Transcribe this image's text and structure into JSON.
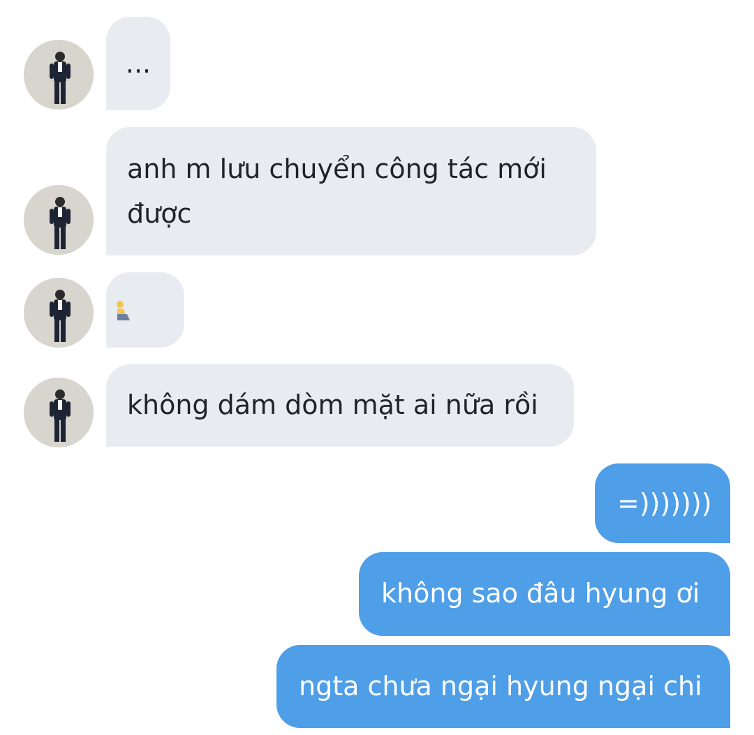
{
  "conversation": {
    "messages": [
      {
        "text": "...",
        "icon": "ellipsis"
      },
      {
        "text": "anh m lưu chuyển công tác mới được"
      },
      {
        "text": "",
        "icon": "person-kneeling-emoji"
      },
      {
        "text": "không dám dòm mặt ai nữa rồi"
      },
      {
        "text": "=)))))))"
      },
      {
        "text": "không sao đâu hyung ơi"
      },
      {
        "text": "ngta chưa ngại hyung ngại chi"
      }
    ]
  },
  "colors": {
    "incoming_bubble": "#e8ecf0",
    "outgoing_bubble": "#4f9ee8",
    "incoming_text": "#1f242a",
    "outgoing_text": "#ffffff"
  }
}
